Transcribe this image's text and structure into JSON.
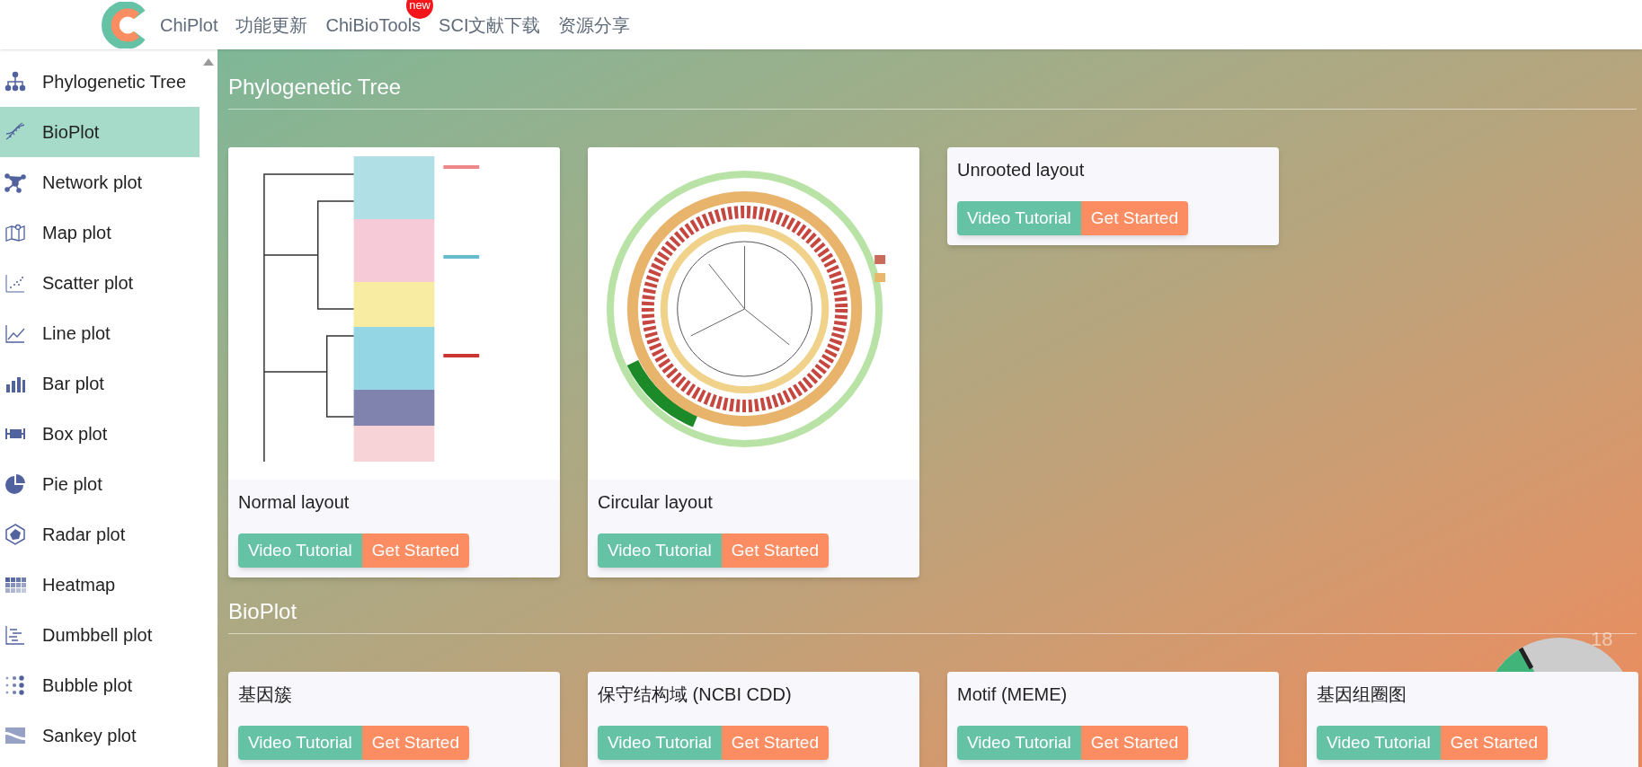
{
  "header": {
    "brand": "ChiPlot",
    "nav": [
      {
        "label": "功能更新"
      },
      {
        "label": "ChiBioTools",
        "badge": "new"
      },
      {
        "label": "SCI文献下载"
      },
      {
        "label": "资源分享"
      }
    ]
  },
  "sidebar": {
    "items": [
      {
        "label": "Phylogenetic Tree",
        "selected": false
      },
      {
        "label": "BioPlot",
        "selected": true
      },
      {
        "label": "Network plot",
        "selected": false
      },
      {
        "label": "Map plot",
        "selected": false
      },
      {
        "label": "Scatter plot",
        "selected": false
      },
      {
        "label": "Line plot",
        "selected": false
      },
      {
        "label": "Bar plot",
        "selected": false
      },
      {
        "label": "Box plot",
        "selected": false
      },
      {
        "label": "Pie plot",
        "selected": false
      },
      {
        "label": "Radar plot",
        "selected": false
      },
      {
        "label": "Heatmap",
        "selected": false
      },
      {
        "label": "Dumbbell plot",
        "selected": false
      },
      {
        "label": "Bubble plot",
        "selected": false
      },
      {
        "label": "Sankey plot",
        "selected": false
      }
    ]
  },
  "sections": [
    {
      "title": "Phylogenetic Tree",
      "cards": [
        {
          "title": "Normal layout",
          "picture": {
            "kind": "picture"
          },
          "buttons": [
            {
              "label": "Video Tutorial",
              "kind": "video"
            },
            {
              "label": "Get Started",
              "kind": "start"
            }
          ]
        },
        {
          "title": "Circular layout",
          "picture": {
            "kind": "picture"
          },
          "buttons": [
            {
              "label": "Video Tutorial",
              "kind": "video"
            },
            {
              "label": "Get Started",
              "kind": "start"
            }
          ]
        },
        {
          "title": "Unrooted layout",
          "buttons": [
            {
              "label": "Video Tutorial",
              "kind": "video"
            },
            {
              "label": "Get Started",
              "kind": "start"
            }
          ]
        }
      ]
    },
    {
      "title": "BioPlot",
      "cards": [
        {
          "title": "基因簇",
          "buttons": [
            {
              "label": "Video Tutorial",
              "kind": "video"
            },
            {
              "label": "Get Started",
              "kind": "start"
            }
          ]
        },
        {
          "title": "保守结构域 (NCBI CDD)",
          "buttons": [
            {
              "label": "Video Tutorial",
              "kind": "video"
            },
            {
              "label": "Get Started",
              "kind": "start"
            }
          ]
        },
        {
          "title": "Motif (MEME)",
          "buttons": [
            {
              "label": "Video Tutorial",
              "kind": "video"
            },
            {
              "label": "Get Started",
              "kind": "start"
            }
          ]
        },
        {
          "title": "基因组圈图",
          "buttons": [
            {
              "label": "Video Tutorial",
              "kind": "video"
            },
            {
              "label": "Get Started",
              "kind": "start"
            }
          ]
        }
      ]
    }
  ],
  "gauge": {
    "reading": "18"
  }
}
